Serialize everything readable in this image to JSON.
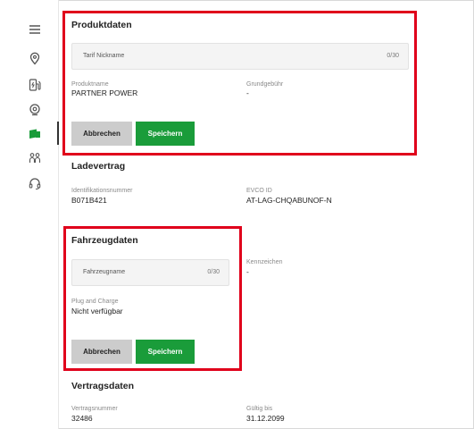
{
  "produktdaten": {
    "title": "Produktdaten",
    "nickname_placeholder": "Tarif Nickname",
    "nickname_count": "0/30",
    "produktname_label": "Produktname",
    "produktname_value": "PARTNER POWER",
    "grundgebuehr_label": "Grundgebühr",
    "grundgebuehr_value": "-",
    "cancel_label": "Abbrechen",
    "save_label": "Speichern"
  },
  "ladevertrag": {
    "title": "Ladevertrag",
    "id_label": "Identifikationsnummer",
    "id_value": "B071B421",
    "evco_label": "EVCO ID",
    "evco_value": "AT-LAG-CHQABUNOF-N"
  },
  "fahrzeugdaten": {
    "title": "Fahrzeugdaten",
    "name_placeholder": "Fahrzeugname",
    "name_count": "0/30",
    "kennzeichen_label": "Kennzeichen",
    "kennzeichen_value": "-",
    "plug_label": "Plug and Charge",
    "plug_value": "Nicht verfügbar",
    "cancel_label": "Abbrechen",
    "save_label": "Speichern"
  },
  "vertragsdaten": {
    "title": "Vertragsdaten",
    "nummer_label": "Vertragsnummer",
    "nummer_value": "32486",
    "gueltig_label": "Gültig bis",
    "gueltig_value": "31.12.2099"
  },
  "sidebar": {
    "icons": [
      "menu-icon",
      "location-pin-icon",
      "charging-station-icon",
      "location-target-icon",
      "card-icon",
      "people-icon",
      "headset-icon"
    ]
  },
  "colors": {
    "accent_green": "#1a9c3a",
    "highlight_red": "#e0001b",
    "cancel_gray": "#cccccc"
  }
}
